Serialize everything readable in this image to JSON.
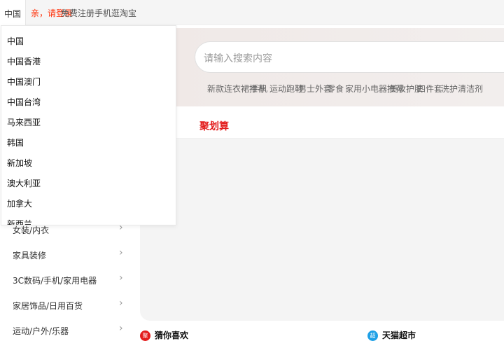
{
  "topbar": {
    "region_label": "中国",
    "links": [
      {
        "label": "亲，请登录",
        "red": true
      },
      {
        "label": "免费注册",
        "red": false
      },
      {
        "label": "手机逛淘宝",
        "red": false
      }
    ]
  },
  "search": {
    "placeholder": "请输入搜索内容"
  },
  "hot_keywords": [
    "新款连衣裙推荐",
    "手机",
    "运动跑鞋",
    "男士外套",
    "零食",
    "家用小电器推荐",
    "美妆护肤",
    "四件套",
    "洗护清洁剂"
  ],
  "tabs": {
    "juhuasuan": "聚划算"
  },
  "region_dropdown": {
    "items": [
      "中国",
      "中国香港",
      "中国澳门",
      "中国台湾",
      "马来西亚",
      "韩国",
      "新加坡",
      "澳大利亚",
      "加拿大",
      "新西兰"
    ]
  },
  "category_nav": {
    "items": [
      "女装/内衣",
      "家具装修",
      "3C数码/手机/家用电器",
      "家居饰品/日用百货",
      "运动/户外/乐器"
    ]
  },
  "bottom_sections": [
    {
      "label": "猜你喜欢",
      "badge": "聚",
      "badge_color": "#e31c1c"
    },
    {
      "label": "天猫超市",
      "badge": "超",
      "badge_color": "#1ea0e6"
    }
  ],
  "colors": {
    "accent": "#ff2a00",
    "juhuasuan": "#e31c1c"
  }
}
